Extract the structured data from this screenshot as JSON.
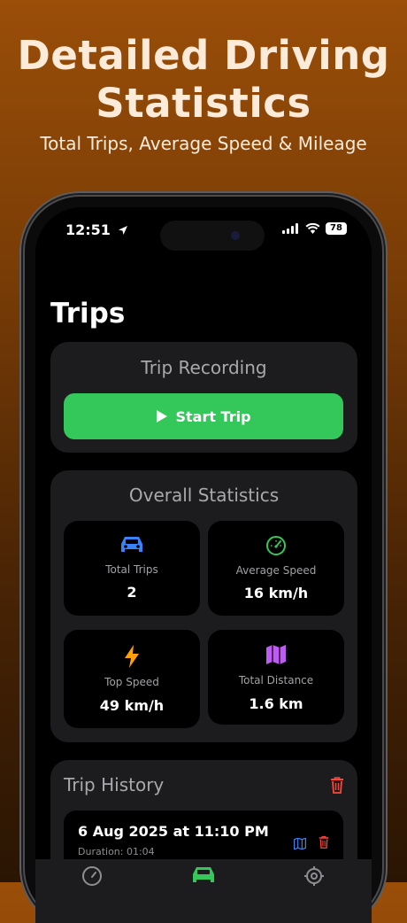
{
  "promo": {
    "headline_line1": "Detailed Driving",
    "headline_line2": "Statistics",
    "subline": "Total Trips, Average Speed & Mileage"
  },
  "status_bar": {
    "time": "12:51",
    "battery": "78"
  },
  "page": {
    "title": "Trips"
  },
  "trip_recording": {
    "title": "Trip Recording",
    "start_button_label": "Start Trip"
  },
  "overall_statistics": {
    "title": "Overall Statistics",
    "tiles": [
      {
        "label": "Total Trips",
        "value": "2",
        "icon": "car-icon",
        "color": "#3a82f7"
      },
      {
        "label": "Average Speed",
        "value": "16 km/h",
        "icon": "speedometer-icon",
        "color": "#34c759"
      },
      {
        "label": "Top Speed",
        "value": "49 km/h",
        "icon": "lightning-icon",
        "color": "#ff9f0a"
      },
      {
        "label": "Total Distance",
        "value": "1.6 km",
        "icon": "map-icon",
        "color": "#bf5af2"
      }
    ]
  },
  "trip_history": {
    "title": "Trip History",
    "trips": [
      {
        "date": "6 Aug 2025 at 11:10 PM",
        "duration": "Duration: 01:04"
      }
    ]
  },
  "tab_bar": {
    "tabs": [
      {
        "icon": "speedometer-icon",
        "active": false
      },
      {
        "icon": "car-icon",
        "active": true
      },
      {
        "icon": "settings-gear-icon",
        "active": false
      }
    ]
  },
  "colors": {
    "accent_green": "#34c759",
    "danger_red": "#ff453a",
    "blue": "#3a82f7",
    "card_bg": "#1c1c1e"
  }
}
